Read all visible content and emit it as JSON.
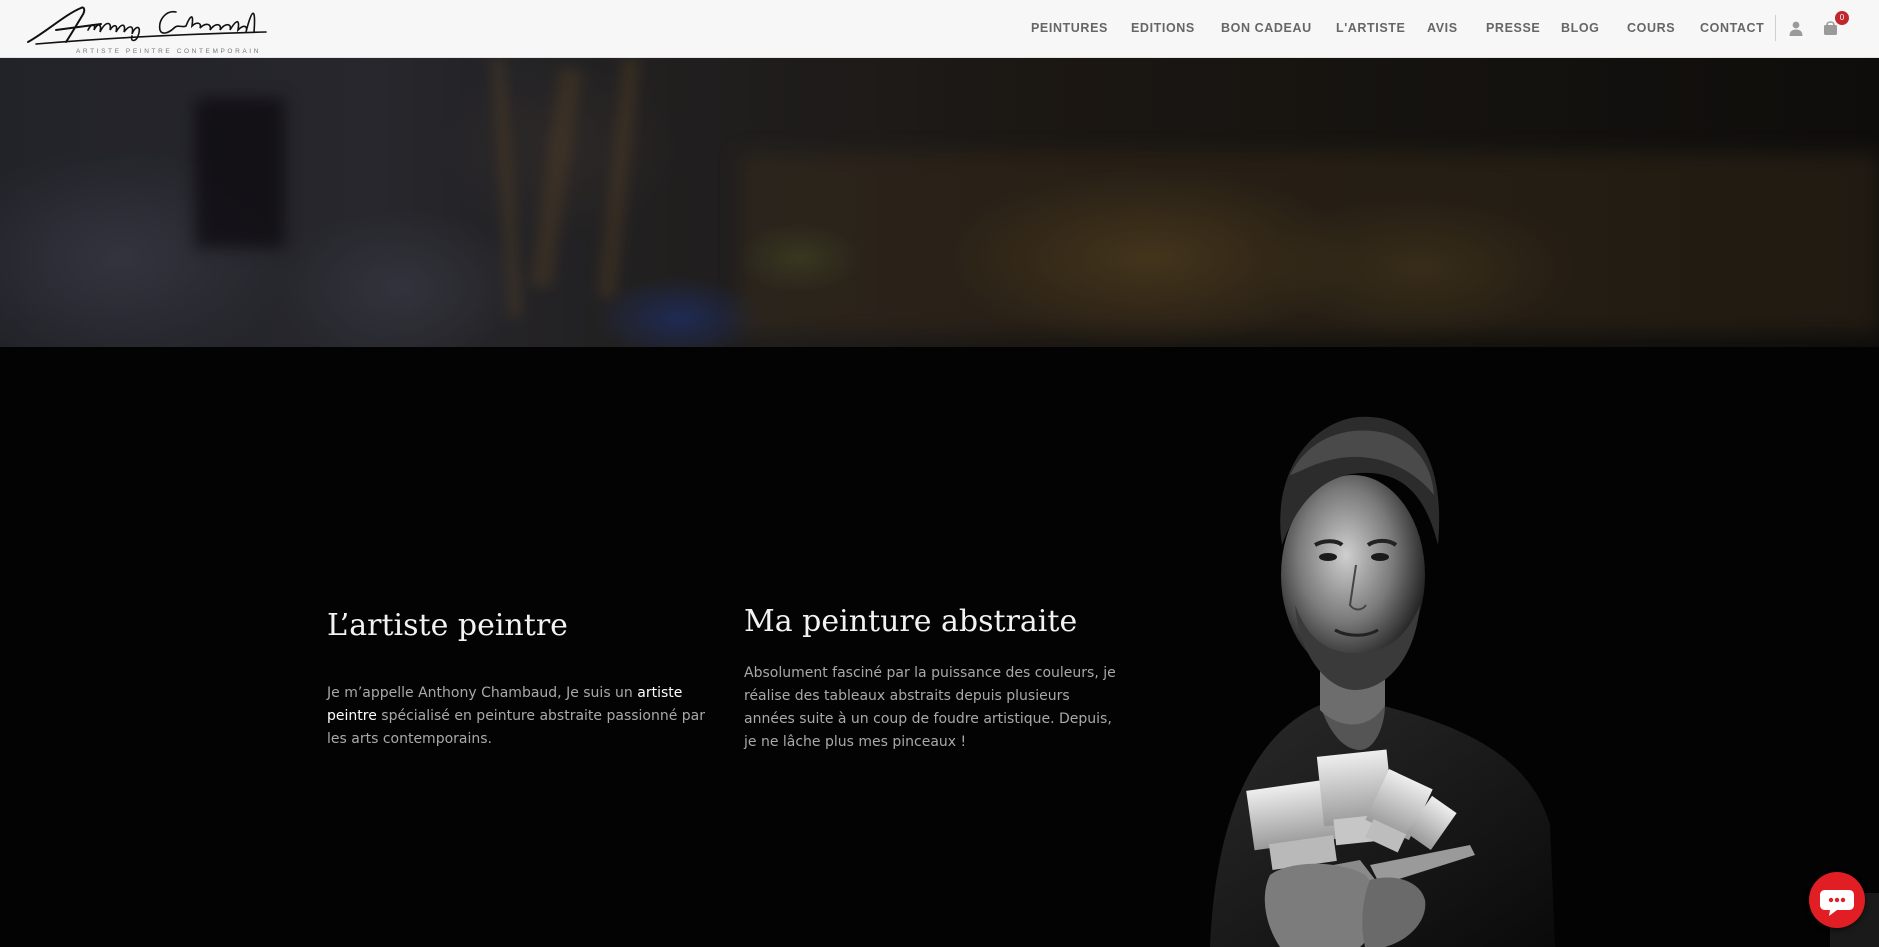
{
  "header": {
    "logo_text": "Anthony Chambaud",
    "logo_tagline": "ARTISTE PEINTRE CONTEMPORAIN",
    "nav": [
      "PEINTURES",
      "EDITIONS",
      "BON CADEAU",
      "L'ARTISTE",
      "AVIS",
      "PRESSE",
      "BLOG",
      "COURS",
      "CONTACT"
    ],
    "cart_count": "0",
    "icons": [
      "user-icon",
      "cart-icon"
    ]
  },
  "left_column": {
    "title": "L’artiste peintre",
    "text_before": "Je m’appelle Anthony Chambaud, Je suis un ",
    "link_text": "artiste peintre",
    "text_after": " spécialisé en peinture abstraite passionné par les arts contemporains."
  },
  "right_column": {
    "title": "Ma peinture abstraite",
    "text": "Absolument fasciné par la puissance des couleurs, je réalise des tableaux abstraits depuis plusieurs années suite à un coup de foudre artistique. Depuis, je ne lâche plus mes pinceaux !"
  },
  "chat": {
    "icon": "chat-bubble-icon"
  },
  "colors": {
    "accent": "#e01e24",
    "background": "#030303",
    "header": "#f7f7f7"
  }
}
